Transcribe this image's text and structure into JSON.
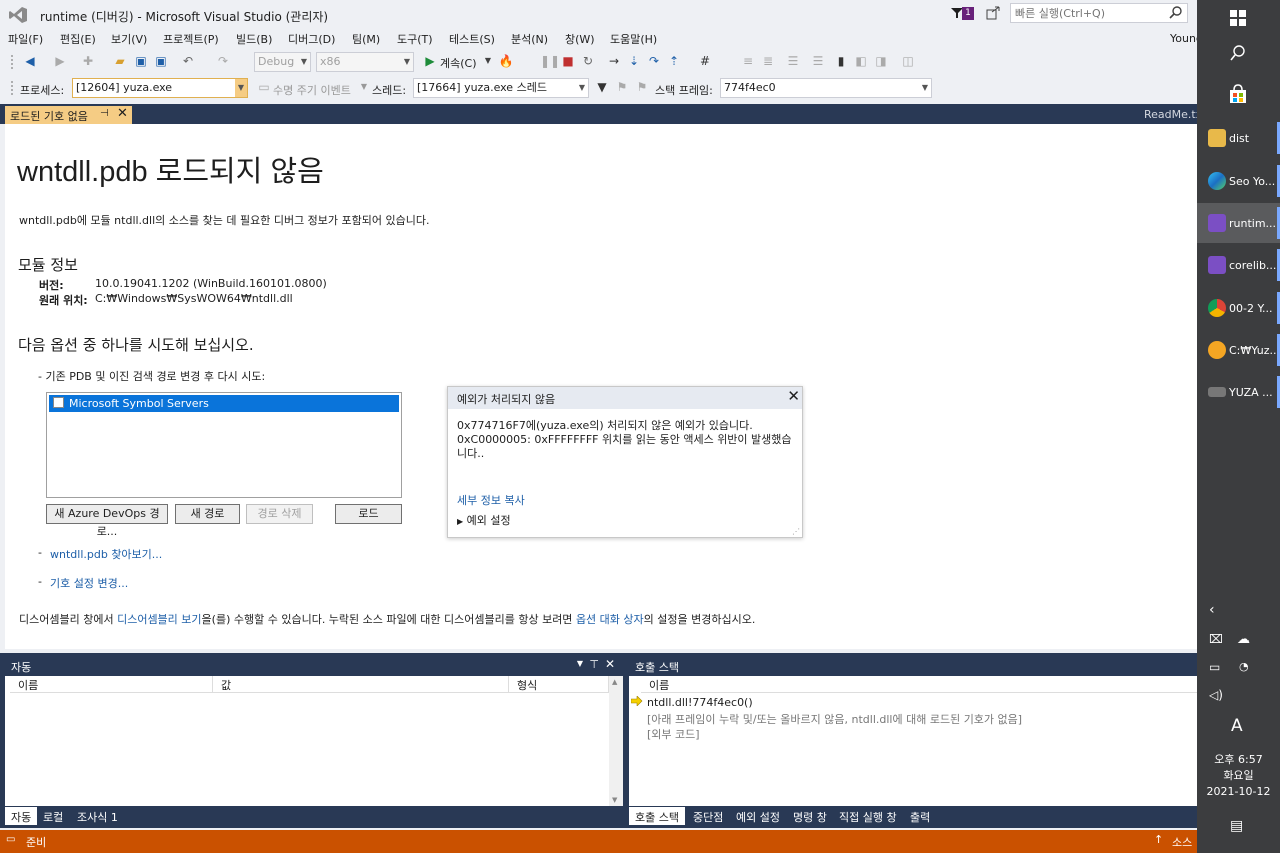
{
  "window": {
    "title": "runtime (디버깅) - Microsoft Visual Studio  (관리자)",
    "notification_count": "1",
    "quick_launch_placeholder": "빠른 실행(Ctrl+Q)",
    "user": "Young"
  },
  "menu": [
    "파일(F)",
    "편집(E)",
    "보기(V)",
    "프로젝트(P)",
    "빌드(B)",
    "디버그(D)",
    "팀(M)",
    "도구(T)",
    "테스트(S)",
    "분석(N)",
    "창(W)",
    "도움말(H)"
  ],
  "toolbar": {
    "config": "Debug",
    "platform": "x86",
    "continue_label": "계속(C)"
  },
  "debug_location": {
    "process_label": "프로세스:",
    "process_value": "[12604] yuza.exe",
    "lifecycle_label": "수명 주기 이벤트",
    "thread_label": "스레드:",
    "thread_value": "[17664] yuza.exe 스레드",
    "stackframe_label": "스택 프레임:",
    "stackframe_value": "774f4ec0"
  },
  "tabs": {
    "active": "로드된 기호 없음",
    "other": "ReadMe.txt"
  },
  "doc": {
    "heading": "wntdll.pdb 로드되지 않음",
    "desc": "wntdll.pdb에 모듈 ntdll.dll의 소스를 찾는 데 필요한 디버그 정보가 포함되어 있습니다.",
    "module_info_title": "모듈 정보",
    "version_label": "버전:",
    "version_value": "10.0.19041.1202 (WinBuild.160101.0800)",
    "location_label": "원래 위치:",
    "location_value": "C:₩Windows₩SysWOW64₩ntdll.dll",
    "options_title": "다음 옵션 중 하나를 시도해 보십시오.",
    "option1": "-  기존 PDB 및 이진 검색 경로 변경 후 다시 시도:",
    "symbol_server": "Microsoft Symbol Servers",
    "btn_new_azure": "새 Azure DevOps 경로...",
    "btn_new_path": "새 경로",
    "btn_delete_path": "경로 삭제",
    "btn_load": "로드",
    "dash": "-",
    "link_browse": "wntdll.pdb 찾아보기...",
    "link_symbol_settings": "기호 설정 변경...",
    "footer_pre": "디스어셈블리 창에서 ",
    "footer_link1": "디스어셈블리 보기",
    "footer_mid": "을(를) 수행할 수 있습니다. 누락된 소스 파일에 대한 디스어셈블리를 항상 보려면 ",
    "footer_link2": "옵션 대화 상자",
    "footer_post": "의 설정을 변경하십시오."
  },
  "exception": {
    "title": "예외가 처리되지 않음",
    "line1": "0x774716F7에(yuza.exe의) 처리되지 않은 예외가 있습니다.",
    "line2": "0xC0000005: 0xFFFFFFFF 위치를 읽는 동안 액세스 위반이 발생했습",
    "line3": "니다..",
    "copy_details": "세부 정보 복사",
    "exception_settings": "예외 설정"
  },
  "auto_pane": {
    "title": "자동",
    "columns": [
      "이름",
      "값",
      "형식"
    ],
    "tabs": [
      "자동",
      "로컬",
      "조사식 1"
    ]
  },
  "callstack_pane": {
    "title": "호출 스택",
    "column": "이름",
    "rows": [
      "ntdll.dll!774f4ec0()",
      "[아래 프레임이 누락 및/또는 올바르지 않음, ntdll.dll에 대해 로드된 기호가 없음]",
      "[외부 코드]"
    ],
    "tabs": [
      "호출 스택",
      "중단점",
      "예외 설정",
      "명령 창",
      "직접 실행 창",
      "출력"
    ]
  },
  "status": {
    "text": "준비",
    "right": "소스"
  },
  "taskbar": {
    "items": [
      "dist",
      "Seo Yo...",
      "runtim...",
      "corelib...",
      "00-2 Y...",
      "C:₩Yuz...",
      "YUZA ..."
    ],
    "time": "오후 6:57",
    "day": "화요일",
    "date": "2021-10-12",
    "ime": "A"
  },
  "colors": {
    "accent_orange": "#ca5100",
    "tab_yellow": "#f5cc84",
    "dark_blue": "#293955",
    "selection": "#0a74da"
  }
}
